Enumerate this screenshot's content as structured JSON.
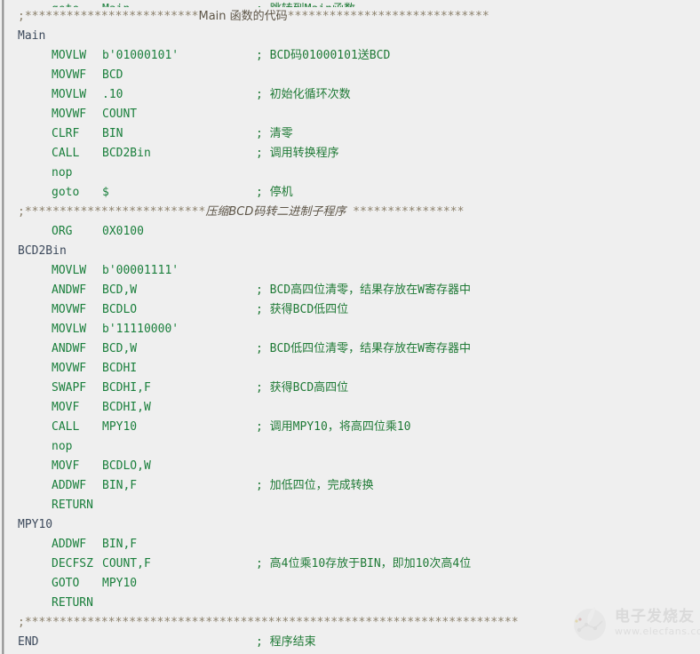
{
  "viewer": {
    "background_color": "#efefef",
    "label_color": "#3d4a5c",
    "code_color": "#1a7f3c",
    "comment_color": "#1f7a36",
    "separator_color": "#8a7f6a"
  },
  "code": {
    "language": "PIC assembly",
    "lines": [
      {
        "label": "",
        "op": "goto",
        "arg": "Main",
        "comment": "; 跳转到Main函数",
        "clipped": true
      },
      {
        "separator": true,
        "text": ";*************************Main 函数的代码*****************************",
        "prefix": ";*************************",
        "title": "Main 函数的代码",
        "suffix": "*****************************"
      },
      {
        "label": "Main",
        "op": "",
        "arg": "",
        "comment": ""
      },
      {
        "label": "",
        "op": "MOVLW",
        "arg": "b'01000101'",
        "comment": "; BCD码01000101送BCD"
      },
      {
        "label": "",
        "op": "MOVWF",
        "arg": "BCD",
        "comment": ""
      },
      {
        "label": "",
        "op": "MOVLW",
        "arg": ".10",
        "comment": "; 初始化循环次数"
      },
      {
        "label": "",
        "op": "MOVWF",
        "arg": "COUNT",
        "comment": ""
      },
      {
        "label": "",
        "op": "CLRF",
        "arg": "BIN",
        "comment": "; 清零"
      },
      {
        "label": "",
        "op": "CALL",
        "arg": "BCD2Bin",
        "comment": "; 调用转换程序"
      },
      {
        "label": "",
        "op": "nop",
        "arg": "",
        "comment": ""
      },
      {
        "label": "",
        "op": "goto",
        "arg": "$",
        "comment": "; 停机"
      },
      {
        "separator": true,
        "text": ";**************************压缩BCD码转二进制子程序 ****************",
        "prefix": ";**************************",
        "title": "压缩BCD码转二进制子程序",
        "suffix": " ****************",
        "italic_title": true
      },
      {
        "label": "",
        "op": "ORG",
        "arg": "0X0100",
        "comment": ""
      },
      {
        "label": "BCD2Bin",
        "op": "",
        "arg": "",
        "comment": ""
      },
      {
        "label": "",
        "op": "MOVLW",
        "arg": "b'00001111'",
        "comment": ""
      },
      {
        "label": "",
        "op": "ANDWF",
        "arg": "BCD,W",
        "comment": "; BCD高四位清零，结果存放在W寄存器中"
      },
      {
        "label": "",
        "op": "MOVWF",
        "arg": "BCDLO",
        "comment": "; 获得BCD低四位"
      },
      {
        "label": "",
        "op": "MOVLW",
        "arg": "b'11110000'",
        "comment": ""
      },
      {
        "label": "",
        "op": "ANDWF",
        "arg": "BCD,W",
        "comment": "; BCD低四位清零，结果存放在W寄存器中"
      },
      {
        "label": "",
        "op": "MOVWF",
        "arg": "BCDHI",
        "comment": ""
      },
      {
        "label": "",
        "op": "SWAPF",
        "arg": "BCDHI,F",
        "comment": "; 获得BCD高四位"
      },
      {
        "label": "",
        "op": "MOVF",
        "arg": "BCDHI,W",
        "comment": ""
      },
      {
        "label": "",
        "op": "CALL",
        "arg": "MPY10",
        "comment": "; 调用MPY10，将高四位乘10"
      },
      {
        "label": "",
        "op": "nop",
        "arg": "",
        "comment": ""
      },
      {
        "label": "",
        "op": "MOVF",
        "arg": "BCDLO,W",
        "comment": ""
      },
      {
        "label": "",
        "op": "ADDWF",
        "arg": "BIN,F",
        "comment": "; 加低四位，完成转换"
      },
      {
        "label": "",
        "op": "RETURN",
        "arg": "",
        "comment": ""
      },
      {
        "label": "MPY10",
        "op": "",
        "arg": "",
        "comment": ""
      },
      {
        "label": "",
        "op": "ADDWF",
        "arg": "BIN,F",
        "comment": ""
      },
      {
        "label": "",
        "op": "DECFSZ",
        "arg": "COUNT,F",
        "comment": "; 高4位乘10存放于BIN，即加10次高4位"
      },
      {
        "label": "",
        "op": "GOTO",
        "arg": "MPY10",
        "comment": ""
      },
      {
        "label": "",
        "op": "RETURN",
        "arg": "",
        "comment": ""
      },
      {
        "separator": true,
        "text": ";***********************************************************************",
        "prefix": ";***********************************************************************",
        "title": "",
        "suffix": ""
      },
      {
        "label": "END",
        "op": "",
        "arg": "",
        "comment": "; 程序结束"
      }
    ]
  },
  "watermark": {
    "brand_cn": "电子发烧友",
    "url": "www.elecfans.com"
  }
}
